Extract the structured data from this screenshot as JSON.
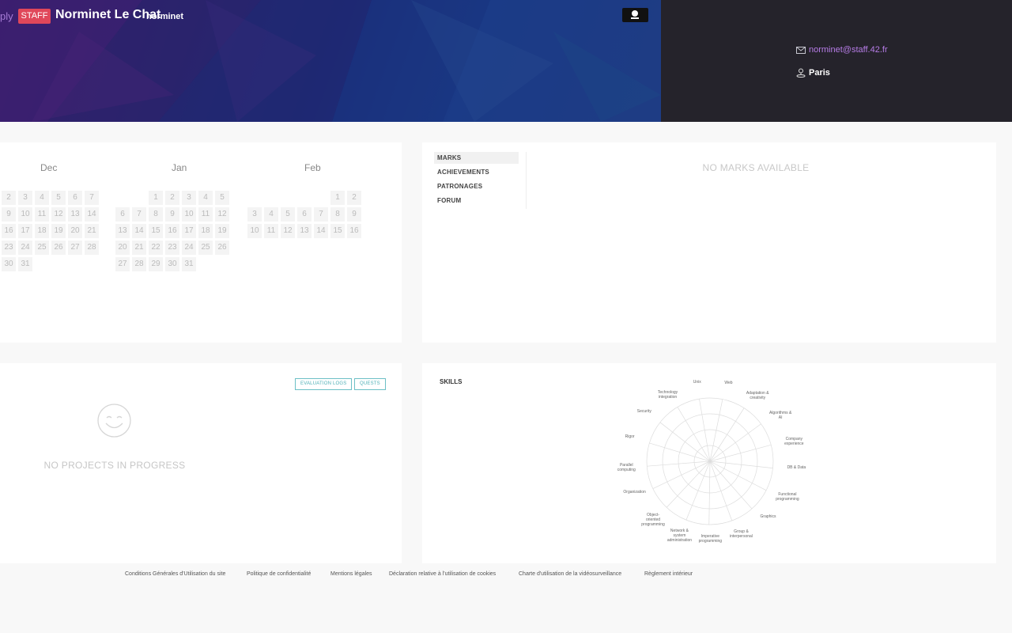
{
  "header": {
    "prev_text": "ply",
    "badge": "STAFF",
    "name": "Norminet Le Chat",
    "login": "norminet",
    "email": "norminet@staff.42.fr",
    "city": "Paris"
  },
  "calendar": {
    "months": [
      {
        "name": "Dec",
        "rows": [
          [
            "2",
            "3",
            "4",
            "5",
            "6",
            "7"
          ],
          [
            "9",
            "10",
            "11",
            "12",
            "13",
            "14"
          ],
          [
            "16",
            "17",
            "18",
            "19",
            "20",
            "21"
          ],
          [
            "23",
            "24",
            "25",
            "26",
            "27",
            "28"
          ],
          [
            "30",
            "31"
          ]
        ]
      },
      {
        "name": "Jan",
        "rows": [
          [
            "",
            "",
            "1",
            "2",
            "3",
            "4",
            "5"
          ],
          [
            "6",
            "7",
            "8",
            "9",
            "10",
            "11",
            "12"
          ],
          [
            "13",
            "14",
            "15",
            "16",
            "17",
            "18",
            "19"
          ],
          [
            "20",
            "21",
            "22",
            "23",
            "24",
            "25",
            "26"
          ],
          [
            "27",
            "28",
            "29",
            "30",
            "31"
          ]
        ]
      },
      {
        "name": "Feb",
        "rows": [
          [
            "",
            "",
            "",
            "",
            "",
            "1",
            "2"
          ],
          [
            "3",
            "4",
            "5",
            "6",
            "7",
            "8",
            "9"
          ],
          [
            "10",
            "11",
            "12",
            "13",
            "14",
            "15",
            "16"
          ]
        ]
      }
    ]
  },
  "marks": {
    "tabs": [
      "MARKS",
      "ACHIEVEMENTS",
      "PATRONAGES",
      "FORUM"
    ],
    "empty_text": "NO MARKS AVAILABLE"
  },
  "projects": {
    "buttons": [
      "EVALUATION LOGS",
      "QUESTS"
    ],
    "empty_text": "NO PROJECTS IN PROGRESS"
  },
  "skills": {
    "title": "SKILLS",
    "labels": [
      "Web",
      "Adaptation &\ncreativity",
      "Algorithms &\nAI",
      "Company\nexperience",
      "DB & Data",
      "Functional\nprogramming",
      "Graphics",
      "Group &\ninterpersonal",
      "Imperative\nprogramming",
      "Network &\nsystem\nadministration",
      "Object-\noriented\nprogramming",
      "Organization",
      "Parallel\ncomputing",
      "Rigor",
      "Security",
      "Technology\nintegration",
      "Unix"
    ]
  },
  "footer": {
    "links": [
      "Conditions Générales d'Utilisation du site",
      "Politique de confidentialité",
      "Mentions légales",
      "Déclaration relative à l'utilisation de cookies",
      "Charte d'utilisation de la vidéosurveillance",
      "Règlement intérieur"
    ]
  }
}
